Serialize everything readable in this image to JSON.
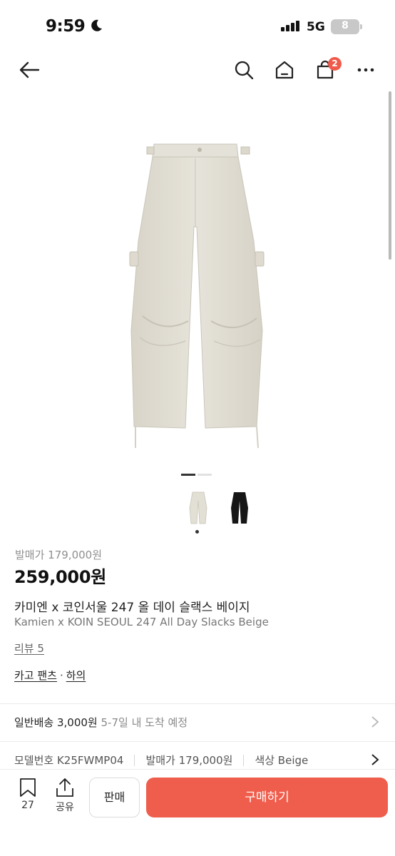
{
  "status_bar": {
    "time": "9:59",
    "network": "5G",
    "battery": "8"
  },
  "nav": {
    "cart_count": "2",
    "icons": [
      "back-arrow-icon",
      "search-icon",
      "home-icon",
      "cart-icon",
      "more-icon"
    ]
  },
  "gallery": {
    "current_index": 1,
    "total": 2,
    "variants": [
      "Beige",
      "Black"
    ]
  },
  "product": {
    "original_price": "발매가 179,000원",
    "price": "259,000원",
    "title_ko": "카미엔 x 코인서울 247 올 데이 슬랙스 베이지",
    "title_en": "Kamien x KOIN SEOUL 247 All Day Slacks Beige",
    "review_label": "리뷰 5",
    "category": [
      "카고 팬츠",
      "하의"
    ]
  },
  "shipping": {
    "label": "일반배송 3,000원",
    "eta": "5-7일 내 도착 예정"
  },
  "specs": {
    "model": "모델번호 K25FWMP04",
    "release_price": "발매가 179,000원",
    "color": "색상 Beige"
  },
  "bottom_bar": {
    "bookmark_count": "27",
    "share_label": "공유",
    "sell_label": "판매",
    "buy_label": "구매하기"
  },
  "colors": {
    "accent": "#ef5d4c",
    "badge": "#ef5a4a",
    "product_beige": "#e3e0d6"
  }
}
